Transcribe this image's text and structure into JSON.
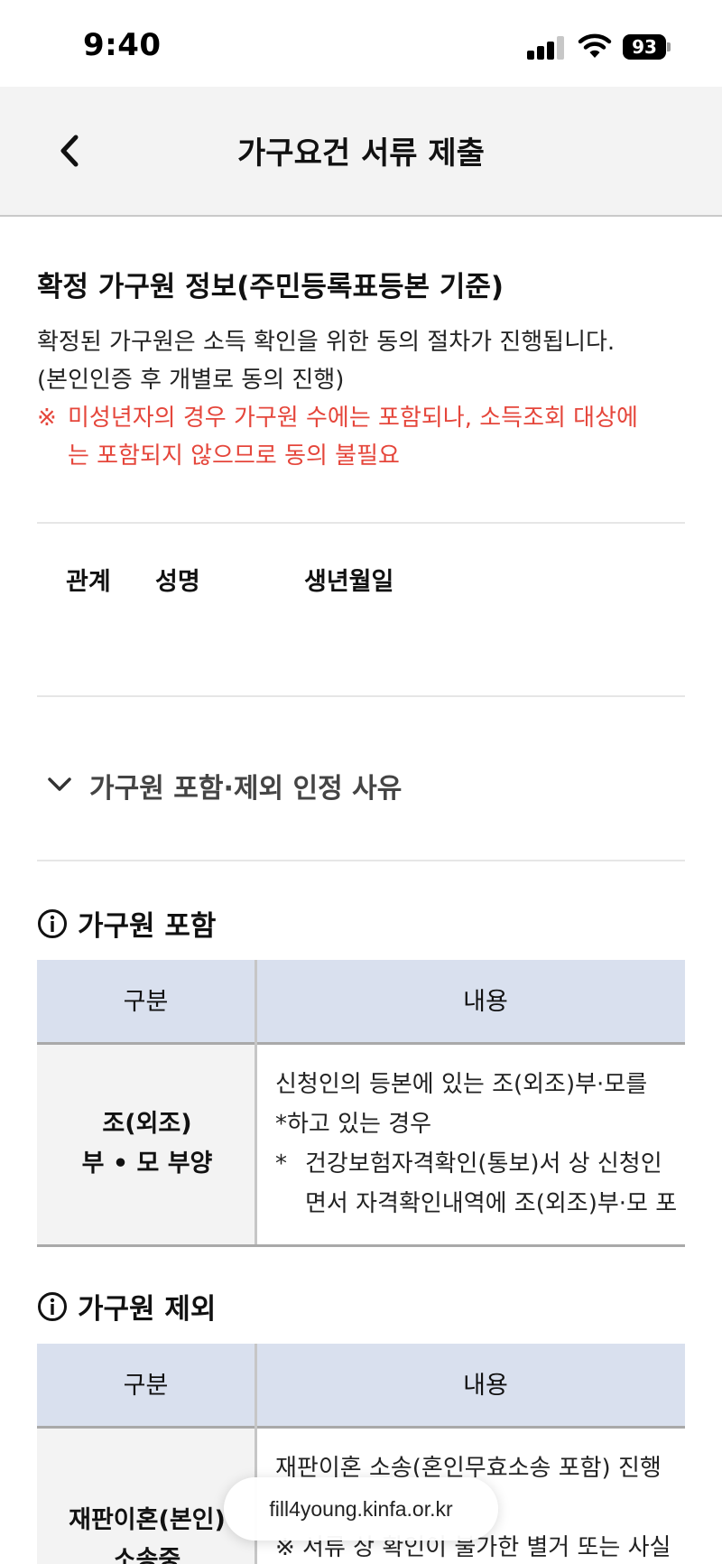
{
  "status_bar": {
    "time": "9:40",
    "battery": "93"
  },
  "header": {
    "title": "가구요건 서류 제출"
  },
  "household_info": {
    "title": "확정 가구원 정보(주민등록표등본 기준)",
    "description_line1": "확정된 가구원은 소득 확인을 위한 동의 절차가 진행됩니다.",
    "description_line2": "(본인인증 후 개별로 동의 진행)",
    "notice_mark": "※",
    "notice_line1": "미성년자의 경우 가구원 수에는 포함되나, 소득조회 대상에",
    "notice_line2": "는 포함되지 않으므로 동의 불필요"
  },
  "member_table": {
    "columns": [
      "관계",
      "성명",
      "생년월일"
    ]
  },
  "accordion": {
    "label": "가구원 포함·제외 인정 사유"
  },
  "inclusion": {
    "title": "가구원 포함",
    "headers": [
      "구분",
      "내용"
    ],
    "row": {
      "category_line1": "조(외조)",
      "category_line2": "부 • 모 부양",
      "content_line1": "신청인의 등본에 있는 조(외조)부·모를 ",
      "content_line2": "*하고 있는 경우",
      "content_line3_mark": "*",
      "content_line3": "건강보험자격확인(통보)서 상 신청인",
      "content_line4": "면서 자격확인내역에 조(외조)부·모 포"
    }
  },
  "exclusion": {
    "title": "가구원 제외",
    "headers": [
      "구분",
      "내용"
    ],
    "row": {
      "category_line1": "재판이혼(본인)",
      "category_line2": "소송중",
      "content_line1": "재판이혼 소송(혼인무효소송 포함) 진행",
      "content_line2": "※ 서류 상 확인이 불가한 별거 또는 사실"
    }
  },
  "browser": {
    "url": "fill4young.kinfa.or.kr"
  }
}
